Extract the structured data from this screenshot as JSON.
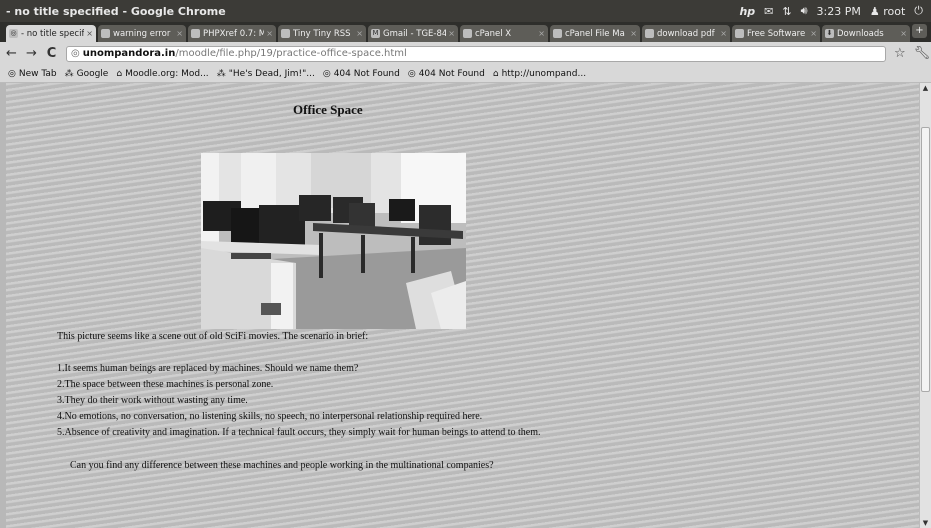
{
  "window": {
    "title": "- no title specified - Google Chrome",
    "clock": "3:23 PM",
    "user": "root"
  },
  "tabs": [
    {
      "label": "- no title specif"
    },
    {
      "label": "warning error"
    },
    {
      "label": "PHPXref 0.7: M"
    },
    {
      "label": "Tiny Tiny RSS"
    },
    {
      "label": "Gmail - TGE-84"
    },
    {
      "label": "cPanel X"
    },
    {
      "label": "cPanel File Ma"
    },
    {
      "label": "download pdf"
    },
    {
      "label": "Free Software"
    },
    {
      "label": "Downloads"
    }
  ],
  "address": {
    "domain": "unompandora.in",
    "path": "/moodle/file.php/19/practice-office-space.html"
  },
  "bookmarks": [
    {
      "label": "New Tab"
    },
    {
      "label": "Google"
    },
    {
      "label": "Moodle.org: Mod..."
    },
    {
      "label": "\"He's Dead, Jim!\"..."
    },
    {
      "label": "404 Not Found"
    },
    {
      "label": "404 Not Found"
    },
    {
      "label": "http://unompand..."
    }
  ],
  "page": {
    "title": "Office Space",
    "intro": "This picture seems like a scene out of old SciFi movies. The scenario in brief:",
    "points": [
      "1.It seems human beings are replaced by machines. Should we name them?",
      "2.The space between these machines is personal zone.",
      "3.They do their work without wasting any time.",
      "4.No emotions, no conversation, no listening skills, no speech, no interpersonal relationship required here.",
      "5.Absence of creativity and imagination. If a technical fault occurs, they simply wait for human beings  to attend to them."
    ],
    "question": "Can you find any difference between these machines and people working in the multinational companies?"
  }
}
